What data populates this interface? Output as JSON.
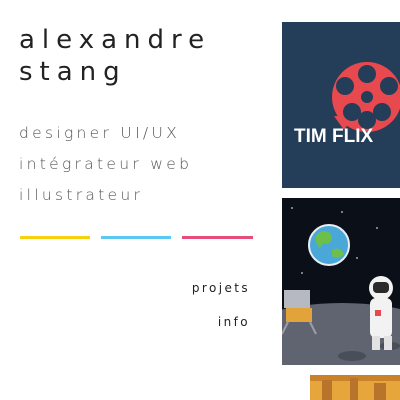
{
  "header": {
    "name_line1": "alexandre",
    "name_line2": "stang"
  },
  "roles": [
    "designer UI/UX",
    "intégrateur web",
    "illustrateur"
  ],
  "accent_colors": [
    "#f6d10f",
    "#5ac8f0",
    "#e64d7a"
  ],
  "nav": {
    "projects_label": "projets",
    "info_label": "info"
  },
  "portfolio": {
    "tiles": [
      {
        "icon": "film-reel-logo",
        "label": "TIM FLIX",
        "background": "#243d58",
        "accent": "#e8494e"
      },
      {
        "icon": "astronaut-moon-illustration",
        "background": "#0b0f18"
      },
      {
        "icon": "desert-illustration",
        "background": "#e7a63c"
      }
    ]
  }
}
